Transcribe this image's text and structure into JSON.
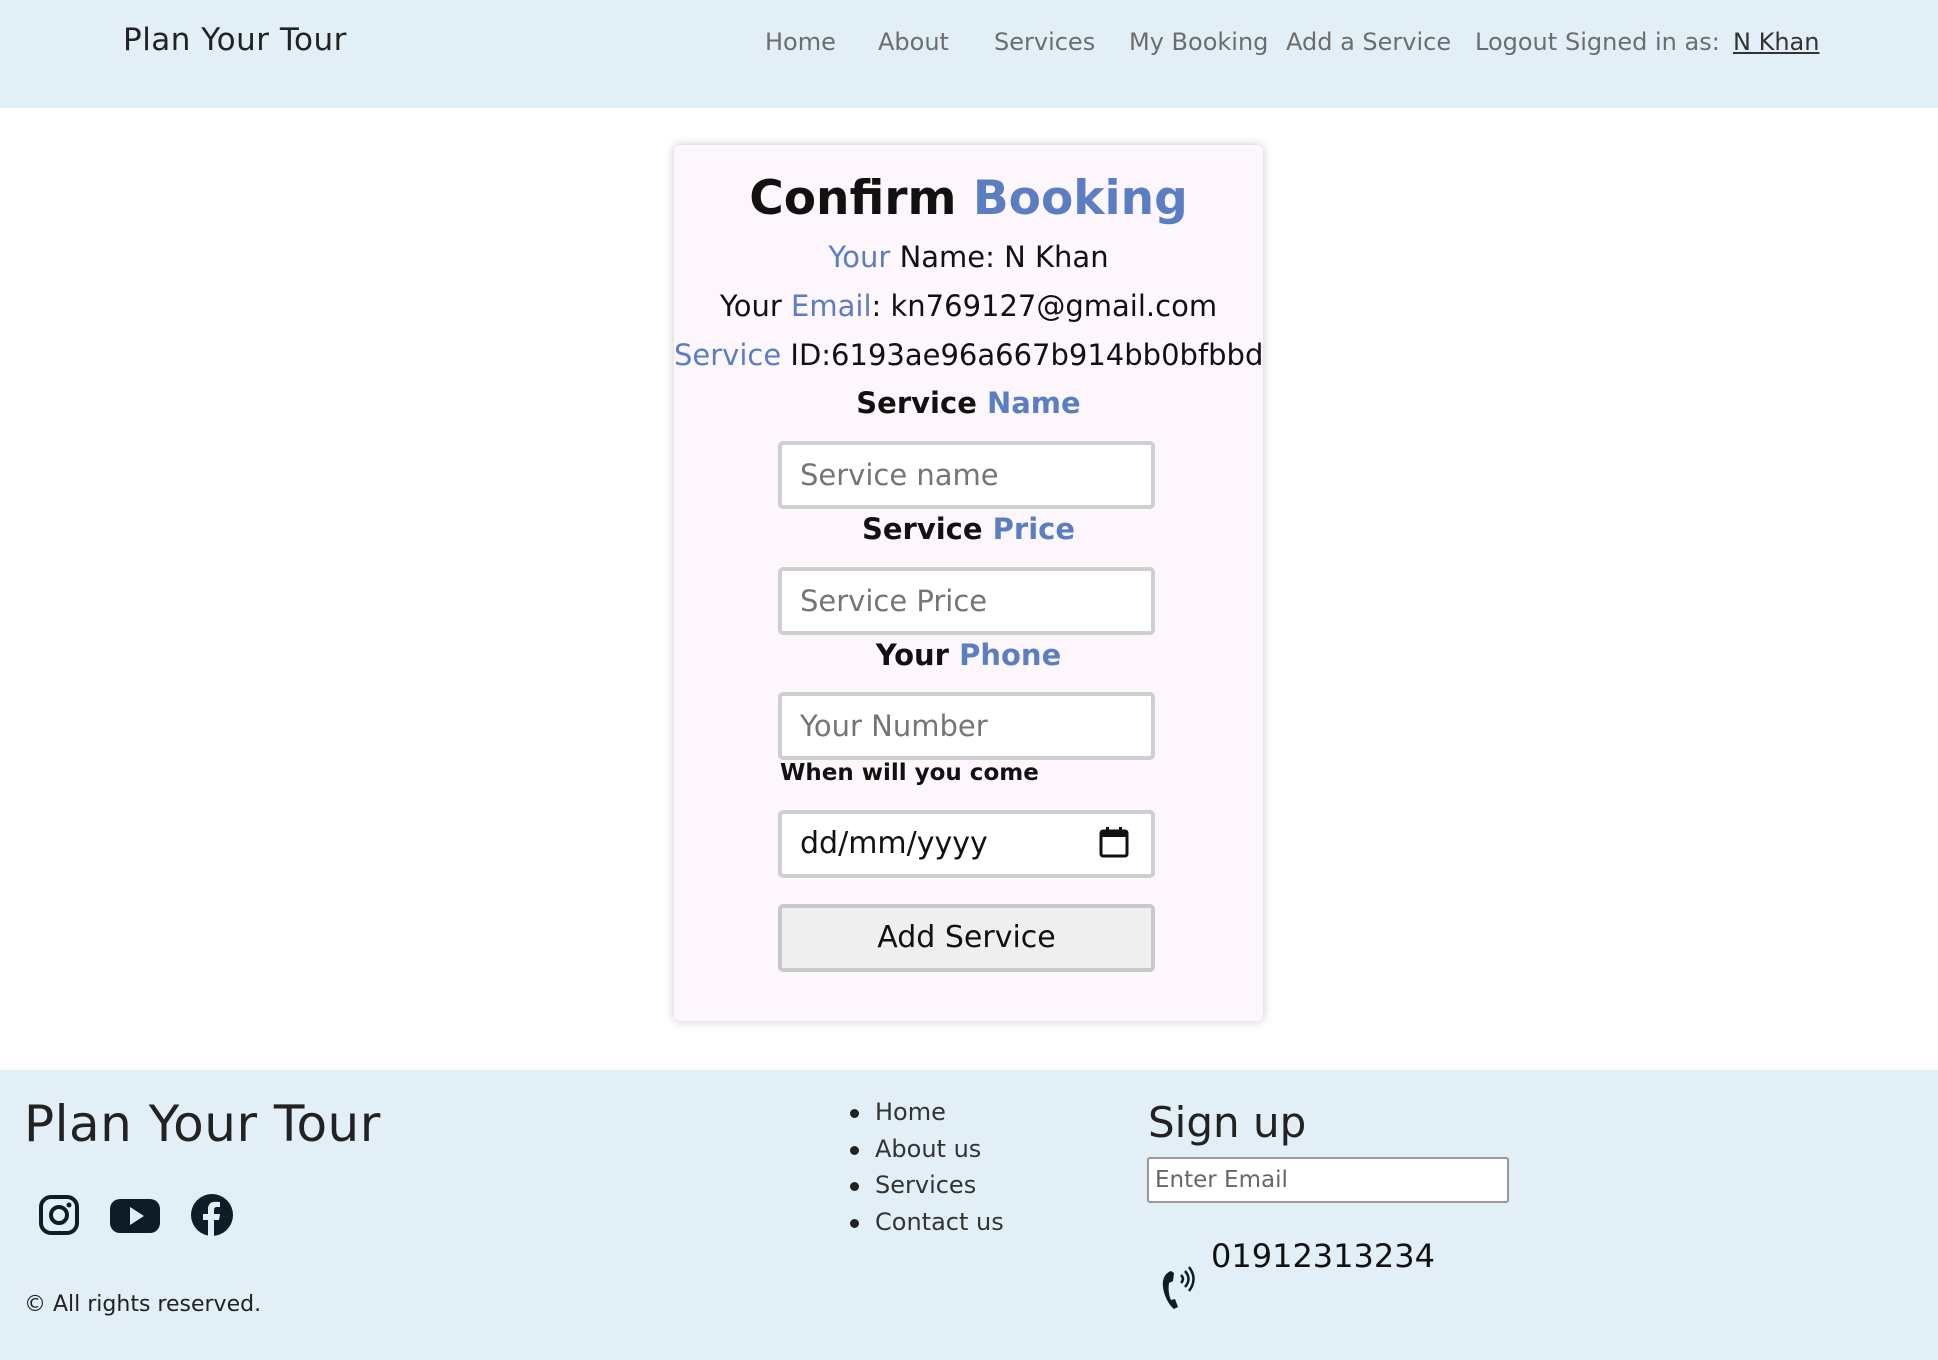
{
  "header": {
    "brand": "Plan Your Tour",
    "nav": [
      "Home",
      "About",
      "Services",
      "My Booking",
      "Add a Service",
      "Logout"
    ],
    "signed_in_label": "Signed in as:",
    "user_name": "N Khan"
  },
  "card": {
    "title_plain": "Confirm",
    "title_accent": "Booking",
    "name_accent": "Your",
    "name_label": "Name:",
    "name_value": "N Khan",
    "email_label_plain": "Your",
    "email_label_accent": "Email",
    "email_value": ": kn769127@gmail.com",
    "service_id_accent": "Service",
    "service_id_value": "ID:6193ae96a667b914bb0bfbbd",
    "service_name_label_plain": "Service",
    "service_name_label_accent": "Name",
    "service_name_placeholder": "Service name",
    "service_price_label_plain": "Service",
    "service_price_label_accent": "Price",
    "service_price_placeholder": "Service Price",
    "phone_label_plain": "Your",
    "phone_label_accent": "Phone",
    "phone_placeholder": "Your Number",
    "date_label": "When will you come",
    "date_placeholder": "dd/mm/yyyy",
    "submit_label": "Add Service"
  },
  "footer": {
    "brand": "Plan Your Tour",
    "social_icons": [
      "instagram-icon",
      "youtube-icon",
      "facebook-icon"
    ],
    "copyright": "© All rights reserved.",
    "links": [
      "Home",
      "About us",
      "Services",
      "Contact us"
    ],
    "signup_title": "Sign up",
    "email_placeholder": "Enter Email",
    "phone": "01912313234"
  },
  "colors": {
    "header_bg": "#e2eff7",
    "accent": "#5b7ec2",
    "card_bg": "#fdf7fd"
  }
}
